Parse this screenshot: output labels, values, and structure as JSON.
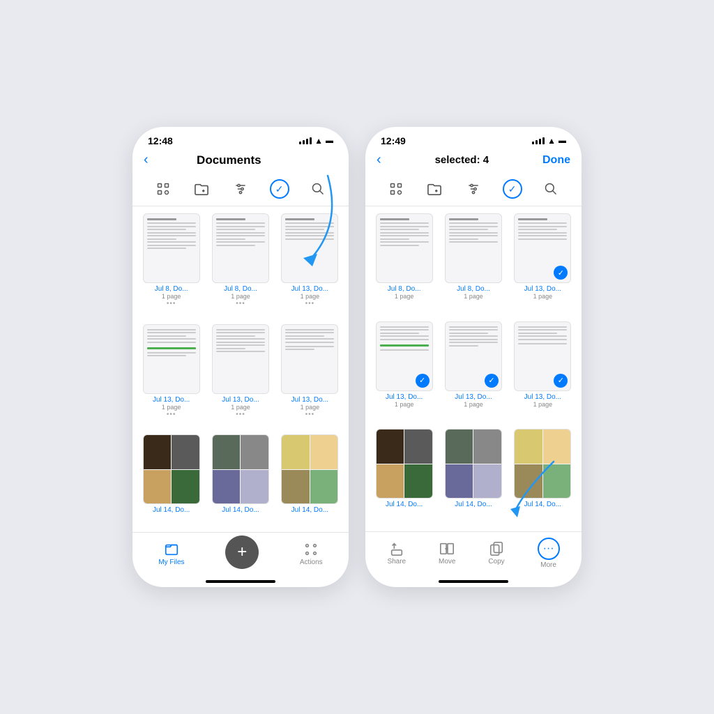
{
  "background_color": "#e8eaf0",
  "phones": [
    {
      "id": "phone-left",
      "status": {
        "time": "12:48",
        "signal": "dots",
        "wifi": true,
        "battery": true
      },
      "nav": {
        "back_label": "‹",
        "title": "Documents",
        "done_label": ""
      },
      "toolbar": {
        "scan_icon": "scan",
        "folder_icon": "folder-plus",
        "filter_icon": "sliders",
        "select_icon": "checkmark-circle",
        "search_icon": "search",
        "select_active": true
      },
      "files": [
        {
          "name": "Jul 8, Do...",
          "pages": "1 page",
          "type": "doc",
          "selected": false
        },
        {
          "name": "Jul 8, Do...",
          "pages": "1 page",
          "type": "doc",
          "selected": false
        },
        {
          "name": "Jul 13, Do...",
          "pages": "1 page",
          "type": "doc",
          "selected": false
        },
        {
          "name": "Jul 13, Do...",
          "pages": "1 page",
          "type": "doc2",
          "selected": false
        },
        {
          "name": "Jul 13, Do...",
          "pages": "1 page",
          "type": "doc2",
          "selected": false
        },
        {
          "name": "Jul 13, Do...",
          "pages": "1 page",
          "type": "doc2",
          "selected": false
        },
        {
          "name": "Jul 14, Do...",
          "pages": "",
          "type": "comic1",
          "selected": false
        },
        {
          "name": "Jul 14, Do...",
          "pages": "",
          "type": "comic2",
          "selected": false
        },
        {
          "name": "Jul 14, Do...",
          "pages": "",
          "type": "comic3",
          "selected": false
        }
      ],
      "bottom": {
        "my_files_label": "My Files",
        "add_label": "+",
        "actions_label": "Actions"
      },
      "annotation": "select_mode_arrow"
    },
    {
      "id": "phone-right",
      "status": {
        "time": "12:49",
        "signal": "dots",
        "wifi": true,
        "battery": true
      },
      "nav": {
        "back_label": "‹",
        "title": "selected: 4",
        "done_label": "Done"
      },
      "toolbar": {
        "scan_icon": "scan",
        "folder_icon": "folder-plus",
        "filter_icon": "sliders",
        "select_icon": "checkmark-circle",
        "search_icon": "search",
        "select_active": false
      },
      "files": [
        {
          "name": "Jul 8, Do...",
          "pages": "1 page",
          "type": "doc",
          "selected": false
        },
        {
          "name": "Jul 8, Do...",
          "pages": "1 page",
          "type": "doc",
          "selected": false
        },
        {
          "name": "Jul 13, Do...",
          "pages": "1 page",
          "type": "doc",
          "selected": true
        },
        {
          "name": "Jul 13, Do...",
          "pages": "1 page",
          "type": "doc2",
          "selected": true
        },
        {
          "name": "Jul 13, Do...",
          "pages": "1 page",
          "type": "doc2",
          "selected": true
        },
        {
          "name": "Jul 13, Do...",
          "pages": "1 page",
          "type": "doc2",
          "selected": true
        },
        {
          "name": "Jul 14, Do...",
          "pages": "",
          "type": "comic1",
          "selected": false
        },
        {
          "name": "Jul 14, Do...",
          "pages": "",
          "type": "comic2",
          "selected": false
        },
        {
          "name": "Jul 14, Do...",
          "pages": "",
          "type": "comic3",
          "selected": false
        }
      ],
      "bottom": {
        "share_label": "Share",
        "move_label": "Move",
        "copy_label": "Copy",
        "more_label": "More"
      },
      "annotation": "more_button_arrow"
    }
  ],
  "arrow_color": "#2196F3"
}
